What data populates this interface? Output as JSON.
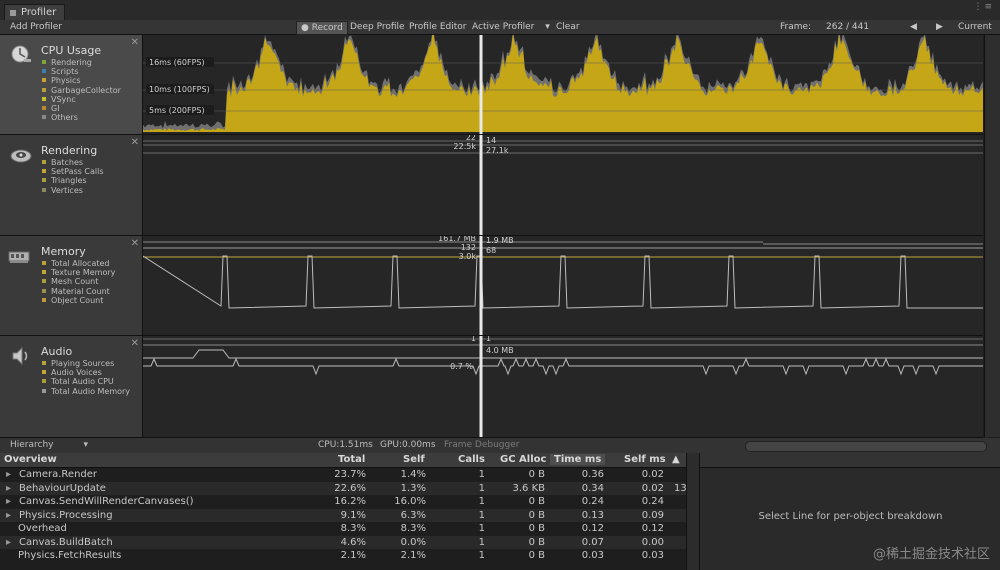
{
  "window": {
    "tab_title": "Profiler"
  },
  "toolbar": {
    "add_profiler": "Add Profiler",
    "record": "Record",
    "deep_profile": "Deep Profile",
    "profile_editor": "Profile Editor",
    "active_profiler": "Active Profiler",
    "clear": "Clear",
    "frame_label": "Frame:",
    "frame_value": "262 / 441",
    "current": "Current",
    "prev_arrow": "◀",
    "next_arrow": "▶"
  },
  "panels": {
    "cpu": {
      "title": "CPU Usage",
      "legend": [
        {
          "label": "Rendering",
          "color": "#7aa63a"
        },
        {
          "label": "Scripts",
          "color": "#3d7fb0"
        },
        {
          "label": "Physics",
          "color": "#c9a23a"
        },
        {
          "label": "GarbageCollector",
          "color": "#b5a23a"
        },
        {
          "label": "VSync",
          "color": "#c7c12c"
        },
        {
          "label": "GI",
          "color": "#b88a2c"
        },
        {
          "label": "Others",
          "color": "#8a8a8a"
        }
      ],
      "markers": [
        "16ms (60FPS)",
        "10ms (100FPS)",
        "5ms (200FPS)"
      ]
    },
    "rendering": {
      "title": "Rendering",
      "legend": [
        {
          "label": "Batches",
          "color": "#b2a33a"
        },
        {
          "label": "SetPass Calls",
          "color": "#c3a53a"
        },
        {
          "label": "Triangles",
          "color": "#a8a03a"
        },
        {
          "label": "Vertices",
          "color": "#8a8a60"
        }
      ],
      "values_left": [
        "22",
        "22.5k"
      ],
      "values_right": [
        "14",
        "27.1k"
      ]
    },
    "memory": {
      "title": "Memory",
      "legend": [
        {
          "label": "Total Allocated",
          "color": "#b8a43a"
        },
        {
          "label": "Texture Memory",
          "color": "#c3a63a"
        },
        {
          "label": "Mesh Count",
          "color": "#aaa03a"
        },
        {
          "label": "Material Count",
          "color": "#9a9050"
        },
        {
          "label": "Object Count",
          "color": "#c09a3a"
        }
      ],
      "values_left": [
        "161.7 MB",
        "132",
        "3.0k"
      ],
      "values_right": [
        "1.9 MB",
        "68"
      ]
    },
    "audio": {
      "title": "Audio",
      "legend": [
        {
          "label": "Playing Sources",
          "color": "#b5a43a"
        },
        {
          "label": "Audio Voices",
          "color": "#c2a63a"
        },
        {
          "label": "Total Audio CPU",
          "color": "#aaa03a"
        },
        {
          "label": "Total Audio Memory",
          "color": "#9a9a9a"
        }
      ],
      "values_left": [
        "1",
        "0.7 %"
      ],
      "values_right": [
        "1",
        "4.0 MB"
      ]
    }
  },
  "bottom_bar": {
    "view": "Hierarchy",
    "dropdown_arrow": "▾",
    "cpu": "CPU:1.51ms",
    "gpu": "GPU:0.00ms",
    "frame_debugger": "Frame Debugger"
  },
  "table": {
    "headers": [
      "Overview",
      "Total",
      "Self",
      "Calls",
      "GC Alloc",
      "Time ms",
      "Self ms"
    ],
    "sort_arrow": "▲",
    "expand_glyph": "▸",
    "rows": [
      {
        "name": "Camera.Render",
        "total": "23.7%",
        "self": "1.4%",
        "calls": "1",
        "gc": "0 B",
        "time": "0.36",
        "selfms": "0.02",
        "extra": "",
        "expand": true
      },
      {
        "name": "BehaviourUpdate",
        "total": "22.6%",
        "self": "1.3%",
        "calls": "1",
        "gc": "3.6 KB",
        "time": "0.34",
        "selfms": "0.02",
        "extra": "13",
        "expand": true
      },
      {
        "name": "Canvas.SendWillRenderCanvases()",
        "total": "16.2%",
        "self": "16.0%",
        "calls": "1",
        "gc": "0 B",
        "time": "0.24",
        "selfms": "0.24",
        "extra": "",
        "expand": true
      },
      {
        "name": "Physics.Processing",
        "total": "9.1%",
        "self": "6.3%",
        "calls": "1",
        "gc": "0 B",
        "time": "0.13",
        "selfms": "0.09",
        "extra": "",
        "expand": true
      },
      {
        "name": "Overhead",
        "total": "8.3%",
        "self": "8.3%",
        "calls": "1",
        "gc": "0 B",
        "time": "0.12",
        "selfms": "0.12",
        "extra": "",
        "expand": false
      },
      {
        "name": "Canvas.BuildBatch",
        "total": "4.6%",
        "self": "0.0%",
        "calls": "1",
        "gc": "0 B",
        "time": "0.07",
        "selfms": "0.00",
        "extra": "",
        "expand": true
      },
      {
        "name": "Physics.FetchResults",
        "total": "2.1%",
        "self": "2.1%",
        "calls": "1",
        "gc": "0 B",
        "time": "0.03",
        "selfms": "0.03",
        "extra": "",
        "expand": false
      }
    ]
  },
  "detail_panel": {
    "message": "Select Line for per-object breakdown"
  },
  "watermark": "@稀土掘金技术社区"
}
